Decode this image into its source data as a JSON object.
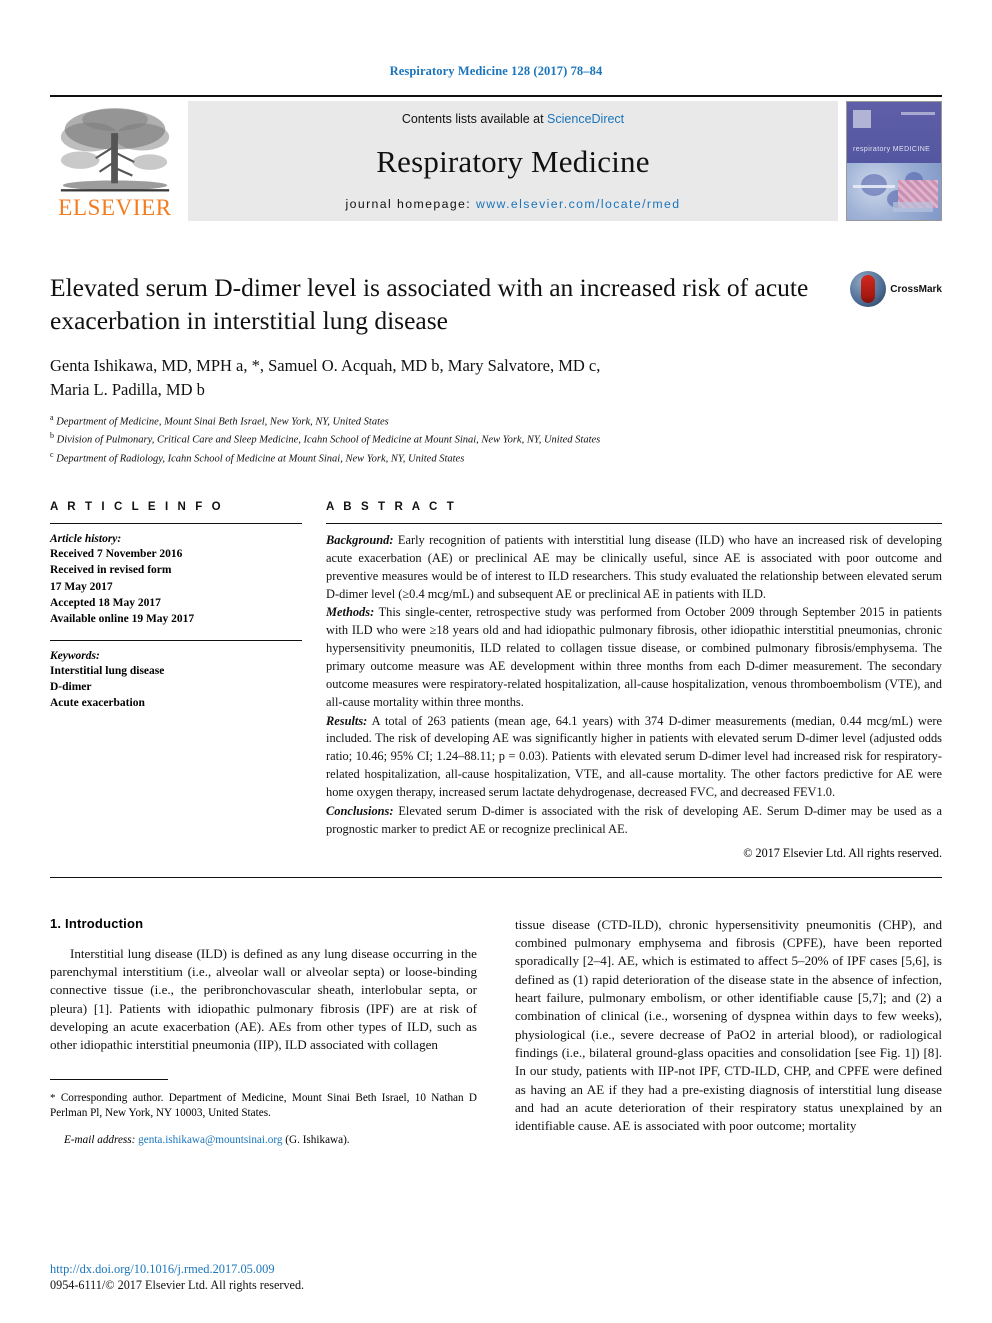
{
  "running_head": "Respiratory Medicine 128 (2017) 78–84",
  "masthead": {
    "contents_prefix": "Contents lists available at ",
    "contents_link": "ScienceDirect",
    "journal_name": "Respiratory Medicine",
    "homepage_prefix": "journal homepage: ",
    "homepage_url": "www.elsevier.com/locate/rmed",
    "publisher": "ELSEVIER",
    "cover_title": "respiratory MEDICINE"
  },
  "article": {
    "title": "Elevated serum D-dimer level is associated with an increased risk of acute exacerbation in interstitial lung disease",
    "crossmark_label": "CrossMark",
    "authors_line_1": "Genta Ishikawa, MD, MPH a, *, Samuel O. Acquah, MD b, Mary Salvatore, MD c,",
    "authors_line_2": "Maria L. Padilla, MD b",
    "affiliations": [
      {
        "mark": "a",
        "text": "Department of Medicine, Mount Sinai Beth Israel, New York, NY, United States"
      },
      {
        "mark": "b",
        "text": "Division of Pulmonary, Critical Care and Sleep Medicine, Icahn School of Medicine at Mount Sinai, New York, NY, United States"
      },
      {
        "mark": "c",
        "text": "Department of Radiology, Icahn School of Medicine at Mount Sinai, New York, NY, United States"
      }
    ]
  },
  "article_info": {
    "heading": "A R T I C L E  I N F O",
    "history_label": "Article history:",
    "history": [
      "Received 7 November 2016",
      "Received in revised form",
      "17 May 2017",
      "Accepted 18 May 2017",
      "Available online 19 May 2017"
    ],
    "keywords_label": "Keywords:",
    "keywords": [
      "Interstitial lung disease",
      "D-dimer",
      "Acute exacerbation"
    ]
  },
  "abstract": {
    "heading": "A B S T R A C T",
    "sections": [
      {
        "lead": "Background:",
        "text": " Early recognition of patients with interstitial lung disease (ILD) who have an increased risk of developing acute exacerbation (AE) or preclinical AE may be clinically useful, since AE is associated with poor outcome and preventive measures would be of interest to ILD researchers. This study evaluated the relationship between elevated serum D-dimer level (≥0.4 mcg/mL) and subsequent AE or preclinical AE in patients with ILD."
      },
      {
        "lead": "Methods:",
        "text": " This single-center, retrospective study was performed from October 2009 through September 2015 in patients with ILD who were ≥18 years old and had idiopathic pulmonary fibrosis, other idiopathic interstitial pneumonias, chronic hypersensitivity pneumonitis, ILD related to collagen tissue disease, or combined pulmonary fibrosis/emphysema. The primary outcome measure was AE development within three months from each D-dimer measurement. The secondary outcome measures were respiratory-related hospitalization, all-cause hospitalization, venous thromboembolism (VTE), and all-cause mortality within three months."
      },
      {
        "lead": "Results:",
        "text": " A total of 263 patients (mean age, 64.1 years) with 374 D-dimer measurements (median, 0.44 mcg/mL) were included. The risk of developing AE was significantly higher in patients with elevated serum D-dimer level (adjusted odds ratio; 10.46; 95% CI; 1.24–88.11; p = 0.03). Patients with elevated serum D-dimer level had increased risk for respiratory-related hospitalization, all-cause hospitalization, VTE, and all-cause mortality. The other factors predictive for AE were home oxygen therapy, increased serum lactate dehydrogenase, decreased FVC, and decreased FEV1.0."
      },
      {
        "lead": "Conclusions:",
        "text": " Elevated serum D-dimer is associated with the risk of developing AE. Serum D-dimer may be used as a prognostic marker to predict AE or recognize preclinical AE."
      }
    ],
    "copyright": "© 2017 Elsevier Ltd. All rights reserved."
  },
  "body": {
    "section_title": "1. Introduction",
    "left_paragraph": "Interstitial lung disease (ILD) is defined as any lung disease occurring in the parenchymal interstitium (i.e., alveolar wall or alveolar septa) or loose-binding connective tissue (i.e., the peribronchovascular sheath, interlobular septa, or pleura) [1]. Patients with idiopathic pulmonary fibrosis (IPF) are at risk of developing an acute exacerbation (AE). AEs from other types of ILD, such as other idiopathic interstitial pneumonia (IIP), ILD associated with collagen",
    "right_paragraph": "tissue disease (CTD-ILD), chronic hypersensitivity pneumonitis (CHP), and combined pulmonary emphysema and fibrosis (CPFE), have been reported sporadically [2–4]. AE, which is estimated to affect 5–20% of IPF cases [5,6], is defined as (1) rapid deterioration of the disease state in the absence of infection, heart failure, pulmonary embolism, or other identifiable cause [5,7]; and (2) a combination of clinical (i.e., worsening of dyspnea within days to few weeks), physiological (i.e., severe decrease of PaO2 in arterial blood), or radiological findings (i.e., bilateral ground-glass opacities and consolidation [see Fig. 1]) [8]. In our study, patients with IIP-not IPF, CTD-ILD, CHP, and CPFE were defined as having an AE if they had a pre-existing diagnosis of interstitial lung disease and had an acute deterioration of their respiratory status unexplained by an identifiable cause. AE is associated with poor outcome; mortality"
  },
  "footnote": {
    "star": "*",
    "corresponding": " Corresponding author. Department of Medicine, Mount Sinai Beth Israel, 10 Nathan D Perlman Pl, New York, NY 10003, United States.",
    "email_label": "E-mail address:",
    "email": "genta.ishikawa@mountsinai.org",
    "email_suffix": " (G. Ishikawa)."
  },
  "footer": {
    "doi": "http://dx.doi.org/10.1016/j.rmed.2017.05.009",
    "issn_line": "0954-6111/© 2017 Elsevier Ltd. All rights reserved."
  },
  "colors": {
    "link_blue": "#1b75bb",
    "elsevier_orange": "#f47c20",
    "masthead_gray": "#e9e9e9"
  }
}
